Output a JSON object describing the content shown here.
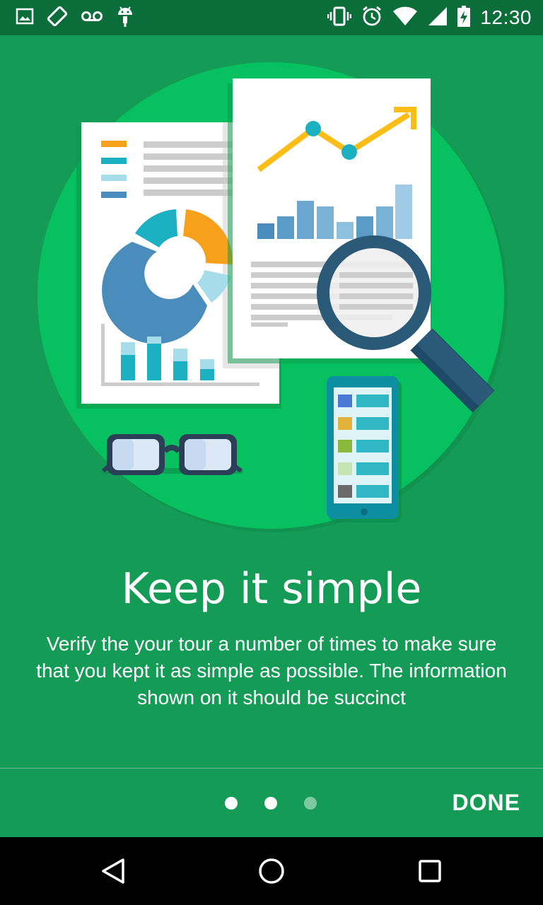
{
  "status_bar": {
    "time": "12:30",
    "left_icons": [
      "image-icon",
      "screen-rotation-icon",
      "voicemail-icon",
      "android-debug-icon"
    ],
    "right_icons": [
      "vibrate-icon",
      "alarm-icon",
      "wifi-icon",
      "cell-signal-icon",
      "battery-charging-icon"
    ]
  },
  "slide": {
    "title": "Keep it simple",
    "description": "Verify the your tour a number of times to make sure that you kept it as simple as possible. The information shown on it should be succinct",
    "illustration": "reports-charts-magnifier-illustration"
  },
  "pager": {
    "page_count": 3,
    "current_page": 2,
    "done_label": "DONE"
  },
  "nav_bar": {
    "buttons": [
      "back",
      "home",
      "recents"
    ]
  },
  "colors": {
    "background": "#149c56",
    "status_bar": "#0b6e3a",
    "circle": "#07c160",
    "accent_orange": "#f7a01c",
    "accent_teal": "#1cb0c3",
    "accent_blue": "#4a8dbd",
    "magnifier": "#2b5a78"
  }
}
